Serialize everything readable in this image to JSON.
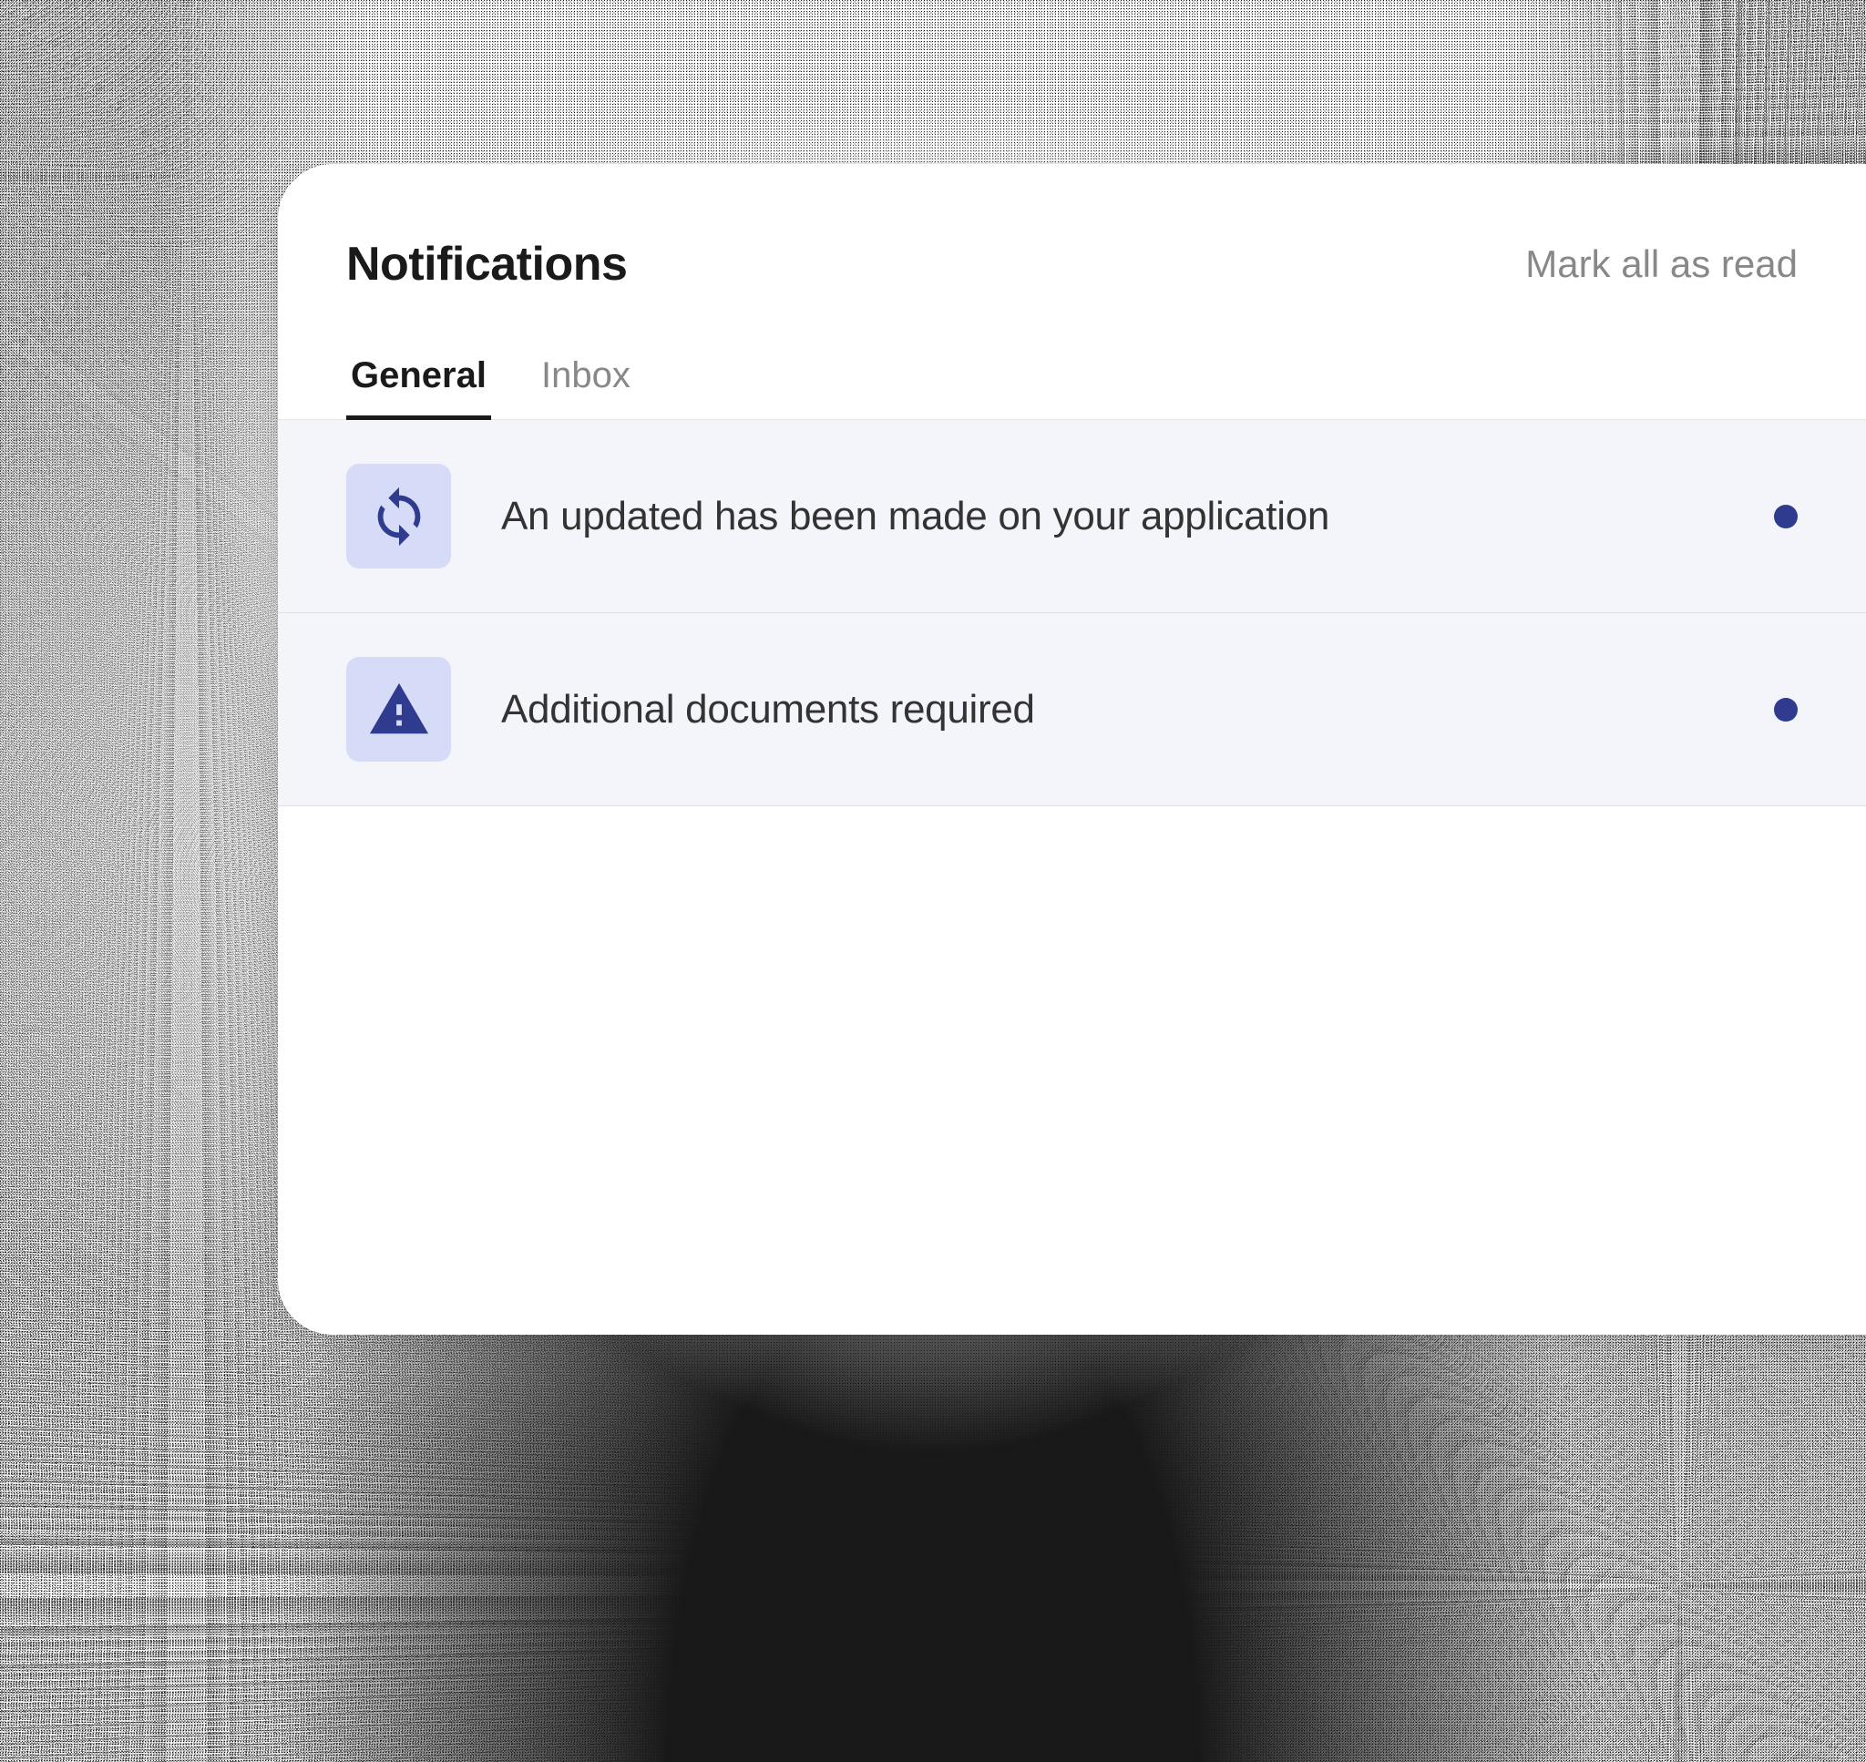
{
  "header": {
    "title": "Notifications",
    "mark_all_label": "Mark all as read"
  },
  "tabs": [
    {
      "label": "General",
      "active": true
    },
    {
      "label": "Inbox",
      "active": false
    }
  ],
  "notifications": [
    {
      "icon": "refresh-icon",
      "message": "An updated has been made on your application",
      "unread": true
    },
    {
      "icon": "warning-icon",
      "message": "Additional documents required",
      "unread": true
    }
  ],
  "colors": {
    "accent": "#2e3b8f",
    "icon_bg": "#d6dcf7",
    "list_bg": "#f4f5fb"
  }
}
